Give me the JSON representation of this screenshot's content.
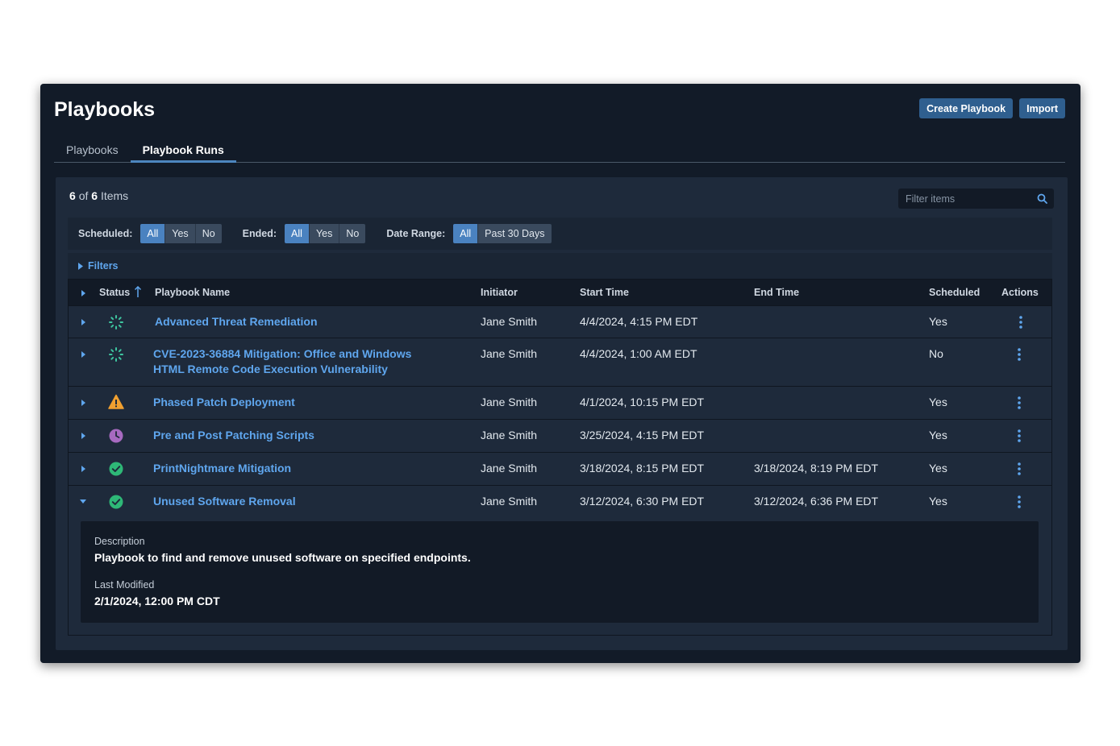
{
  "header": {
    "title": "Playbooks",
    "create_label": "Create Playbook",
    "import_label": "Import"
  },
  "tabs": [
    {
      "label": "Playbooks",
      "active": false
    },
    {
      "label": "Playbook Runs",
      "active": true
    }
  ],
  "summary": {
    "shown": "6",
    "of": "of",
    "total": "6",
    "items": "Items"
  },
  "filter": {
    "placeholder": "Filter items"
  },
  "segments": {
    "scheduled": {
      "label": "Scheduled:",
      "options": [
        "All",
        "Yes",
        "No"
      ],
      "selected": "All"
    },
    "ended": {
      "label": "Ended:",
      "options": [
        "All",
        "Yes",
        "No"
      ],
      "selected": "All"
    },
    "date_range": {
      "label": "Date Range:",
      "options": [
        "All",
        "Past 30 Days"
      ],
      "selected": "All"
    }
  },
  "filters_toggle": {
    "label": "Filters"
  },
  "columns": {
    "status": "Status",
    "name": "Playbook Name",
    "initiator": "Initiator",
    "start": "Start Time",
    "end": "End Time",
    "scheduled": "Scheduled",
    "actions": "Actions"
  },
  "rows": [
    {
      "status": "running",
      "name": "Advanced Threat Remediation",
      "initiator": "Jane Smith",
      "start": "4/4/2024, 4:15 PM EDT",
      "end": "",
      "scheduled": "Yes"
    },
    {
      "status": "running",
      "name_line1": "CVE-2023-36884 Mitigation: Office and Windows",
      "name_line2": "HTML Remote Code Execution Vulnerability",
      "initiator": "Jane Smith",
      "start": "4/4/2024, 1:00 AM EDT",
      "end": "",
      "scheduled": "No"
    },
    {
      "status": "warning",
      "name": "Phased Patch Deployment",
      "initiator": "Jane Smith",
      "start": "4/1/2024, 10:15 PM EDT",
      "end": "",
      "scheduled": "Yes"
    },
    {
      "status": "scheduled",
      "name": "Pre and Post Patching Scripts",
      "initiator": "Jane Smith",
      "start": "3/25/2024, 4:15 PM EDT",
      "end": "",
      "scheduled": "Yes"
    },
    {
      "status": "success",
      "name": "PrintNightmare Mitigation",
      "initiator": "Jane Smith",
      "start": "3/18/2024, 8:15 PM EDT",
      "end": "3/18/2024, 8:19 PM EDT",
      "scheduled": "Yes"
    },
    {
      "status": "success",
      "name": "Unused Software Removal",
      "initiator": "Jane Smith",
      "start": "3/12/2024, 6:30 PM EDT",
      "end": "3/12/2024, 6:36 PM EDT",
      "scheduled": "Yes",
      "expanded": true
    }
  ],
  "detail": {
    "description_label": "Description",
    "description": "Playbook to find and remove unused software on specified endpoints.",
    "modified_label": "Last Modified",
    "modified": "2/1/2024, 12:00 PM CDT"
  },
  "colors": {
    "accent": "#4a82c0",
    "link": "#5fa6ee",
    "running": "#3ec6a0",
    "warning": "#f0a030",
    "scheduled": "#a76ac0",
    "success": "#2eb877"
  }
}
